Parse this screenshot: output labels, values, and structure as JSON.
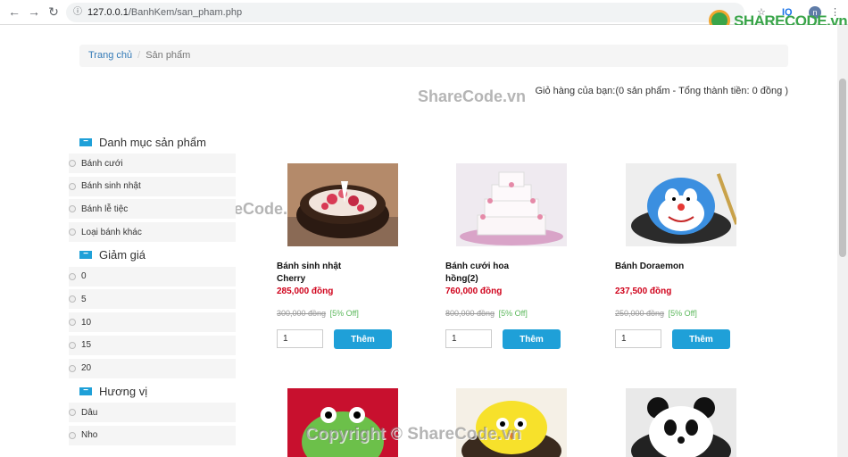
{
  "browser": {
    "url_host": "127.0.0.1",
    "url_path": "/BanhKem/san_pham.php",
    "ext_iq": "IQ",
    "profile_initial": "n",
    "star_icon": "star-icon",
    "menu_icon": "kebab-menu-icon"
  },
  "logo": {
    "brand_a": "SHARE",
    "brand_b": "CODE.vn"
  },
  "breadcrumb": {
    "home": "Trang chủ",
    "separator": "/",
    "current": "Sản phẩm"
  },
  "cart": {
    "text": "Giỏ hàng của bạn:(0 sản phẩm - Tổng thành tiền: 0 đồng )"
  },
  "watermarks": {
    "top": "ShareCode.vn",
    "middle": "ShareCode.vn",
    "bottom": "Copyright © ShareCode.vn"
  },
  "sidebar": {
    "categories": {
      "title": "Danh mục sản phẩm",
      "items": [
        "Bánh cưới",
        "Bánh sinh nhật",
        "Bánh lễ tiệc",
        "Loại bánh khác"
      ]
    },
    "discounts": {
      "title": "Giảm giá",
      "items": [
        "0",
        "5",
        "10",
        "15",
        "20"
      ]
    },
    "flavors": {
      "title": "Hương vị",
      "items": [
        "Dâu",
        "Nho"
      ]
    }
  },
  "products": [
    {
      "name": "Bánh sinh nhật Cherry",
      "price": "285,000 đồng",
      "old_price": "300,000 đồng",
      "discount": "[5% Off]",
      "qty": "1",
      "add_label": "Thêm"
    },
    {
      "name": "Bánh cưới hoa hồng(2)",
      "price": "760,000 đồng",
      "old_price": "800,000 đồng",
      "discount": "[5% Off]",
      "qty": "1",
      "add_label": "Thêm"
    },
    {
      "name": "Bánh Doraemon",
      "price": "237,500 đồng",
      "old_price": "250,000 đồng",
      "discount": "[5% Off]",
      "qty": "1",
      "add_label": "Thêm"
    }
  ],
  "colors": {
    "accent": "#1fa0d8",
    "price": "#d0021b",
    "discount": "#5cb85c",
    "link": "#337ab7"
  }
}
